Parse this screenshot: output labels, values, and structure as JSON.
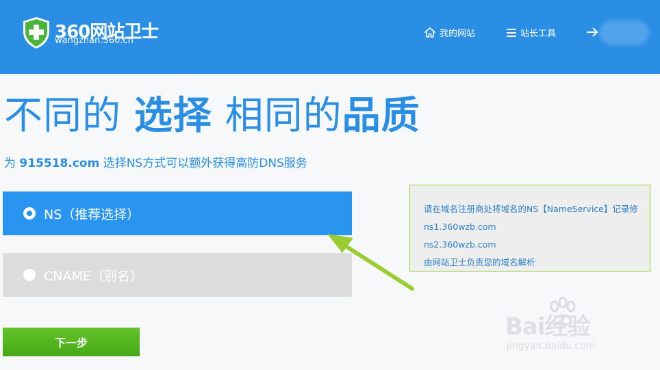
{
  "header": {
    "logo_name": "360网站卫士",
    "logo_domain": "wangzhan.360.cn",
    "nav": {
      "my_sites": "我的网站",
      "webmaster_tools": "站长工具"
    }
  },
  "hero": {
    "part1": "不同的 ",
    "part2": "选择",
    "part3": " 相同的",
    "part4": "品质"
  },
  "subtitle": {
    "prefix": "为 ",
    "domain": "915518.com",
    "suffix": " 选择NS方式可以额外获得高防DNS服务"
  },
  "options": [
    {
      "label": "NS（推荐选择）",
      "selected": true
    },
    {
      "label": "CNAME（别名）",
      "selected": false
    }
  ],
  "info": {
    "line1": "请在域名注册商处将域名的NS【NameService】记录修",
    "line2": "ns1.360wzb.com",
    "line3": "ns2.360wzb.com",
    "line4": "由网站卫士负责您的域名解析"
  },
  "next_button": "下一步",
  "watermark": {
    "brand": "Bai经验",
    "domain": "jingyan.baidu.com"
  },
  "colors": {
    "header_blue": "#2a8ee5",
    "option_selected": "#2a95f0",
    "option_unselected": "#dcdcdc",
    "next_green": "#52b41f",
    "annotation_green": "#9acd32"
  }
}
